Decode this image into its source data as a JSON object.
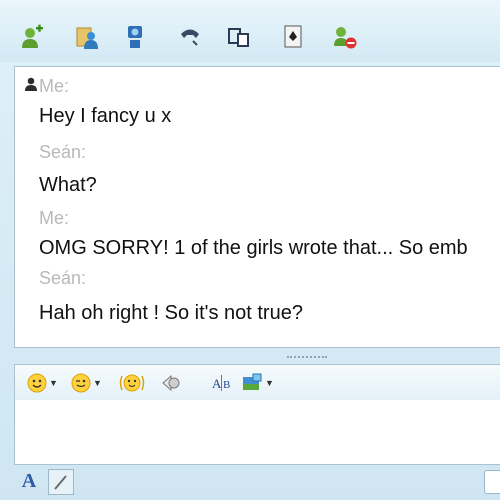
{
  "toolbar": {
    "icons": [
      "invite-contact-icon",
      "share-files-icon",
      "video-call-icon",
      "phone-call-icon",
      "activities-icon",
      "games-icon",
      "block-contact-icon"
    ]
  },
  "conversation": {
    "messages": [
      {
        "sender": "Me:",
        "text": "Hey I fancy u x"
      },
      {
        "sender": "Seán:",
        "text": "What?"
      },
      {
        "sender": "Me:",
        "text": "OMG SORRY! 1 of the girls wrote that... So emb"
      },
      {
        "sender": "Seán:",
        "text": "Hah oh right ! So it's not true?"
      }
    ]
  },
  "emoticon_bar": {
    "icons": [
      "emoticon-icon",
      "wink-icon",
      "animated-emoticon-icon",
      "nudge-icon",
      "translate-icon",
      "background-icon"
    ]
  },
  "compose": {
    "value": ""
  },
  "bottombar": {
    "font_label": "A"
  }
}
